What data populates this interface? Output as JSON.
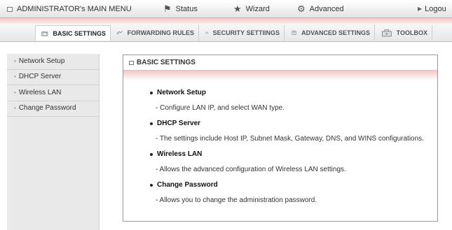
{
  "topbar": {
    "main_menu": "ADMINISTRATOR's MAIN MENU",
    "status": "Status",
    "wizard": "Wizard",
    "advanced": "Advanced",
    "logout": "Logou"
  },
  "tabs": [
    {
      "label": "BASIC SETTINGS",
      "icon": "folder-icon"
    },
    {
      "label": "FORWARDING RULES",
      "icon": "arrows-icon"
    },
    {
      "label": "SECURITY SETTIINGS",
      "icon": "lock-icon"
    },
    {
      "label": "ADVANCED SETTINGS",
      "icon": "gear-icon"
    },
    {
      "label": "TOOLBOX",
      "icon": "toolbox-icon"
    }
  ],
  "sidebar": {
    "items": [
      {
        "label": "Network Setup"
      },
      {
        "label": "DHCP Server"
      },
      {
        "label": "Wireless LAN"
      },
      {
        "label": "Change Password"
      }
    ]
  },
  "panel": {
    "title": "BASIC SETTINGS",
    "entries": [
      {
        "title": "Network Setup",
        "desc": "- Configure LAN IP, and select WAN type."
      },
      {
        "title": "DHCP Server",
        "desc": "- The settings include Host IP, Subnet Mask, Gateway, DNS, and WINS configurations."
      },
      {
        "title": "Wireless LAN",
        "desc": "- Allows the advanced configuration of Wireless LAN settings."
      },
      {
        "title": "Change Password",
        "desc": "- Allows you to change the administration password."
      }
    ]
  },
  "colors": {
    "pink_stripe": "#f8c6c6",
    "sidebar_bg": "#e9e9e9",
    "panel_border": "#999999"
  }
}
